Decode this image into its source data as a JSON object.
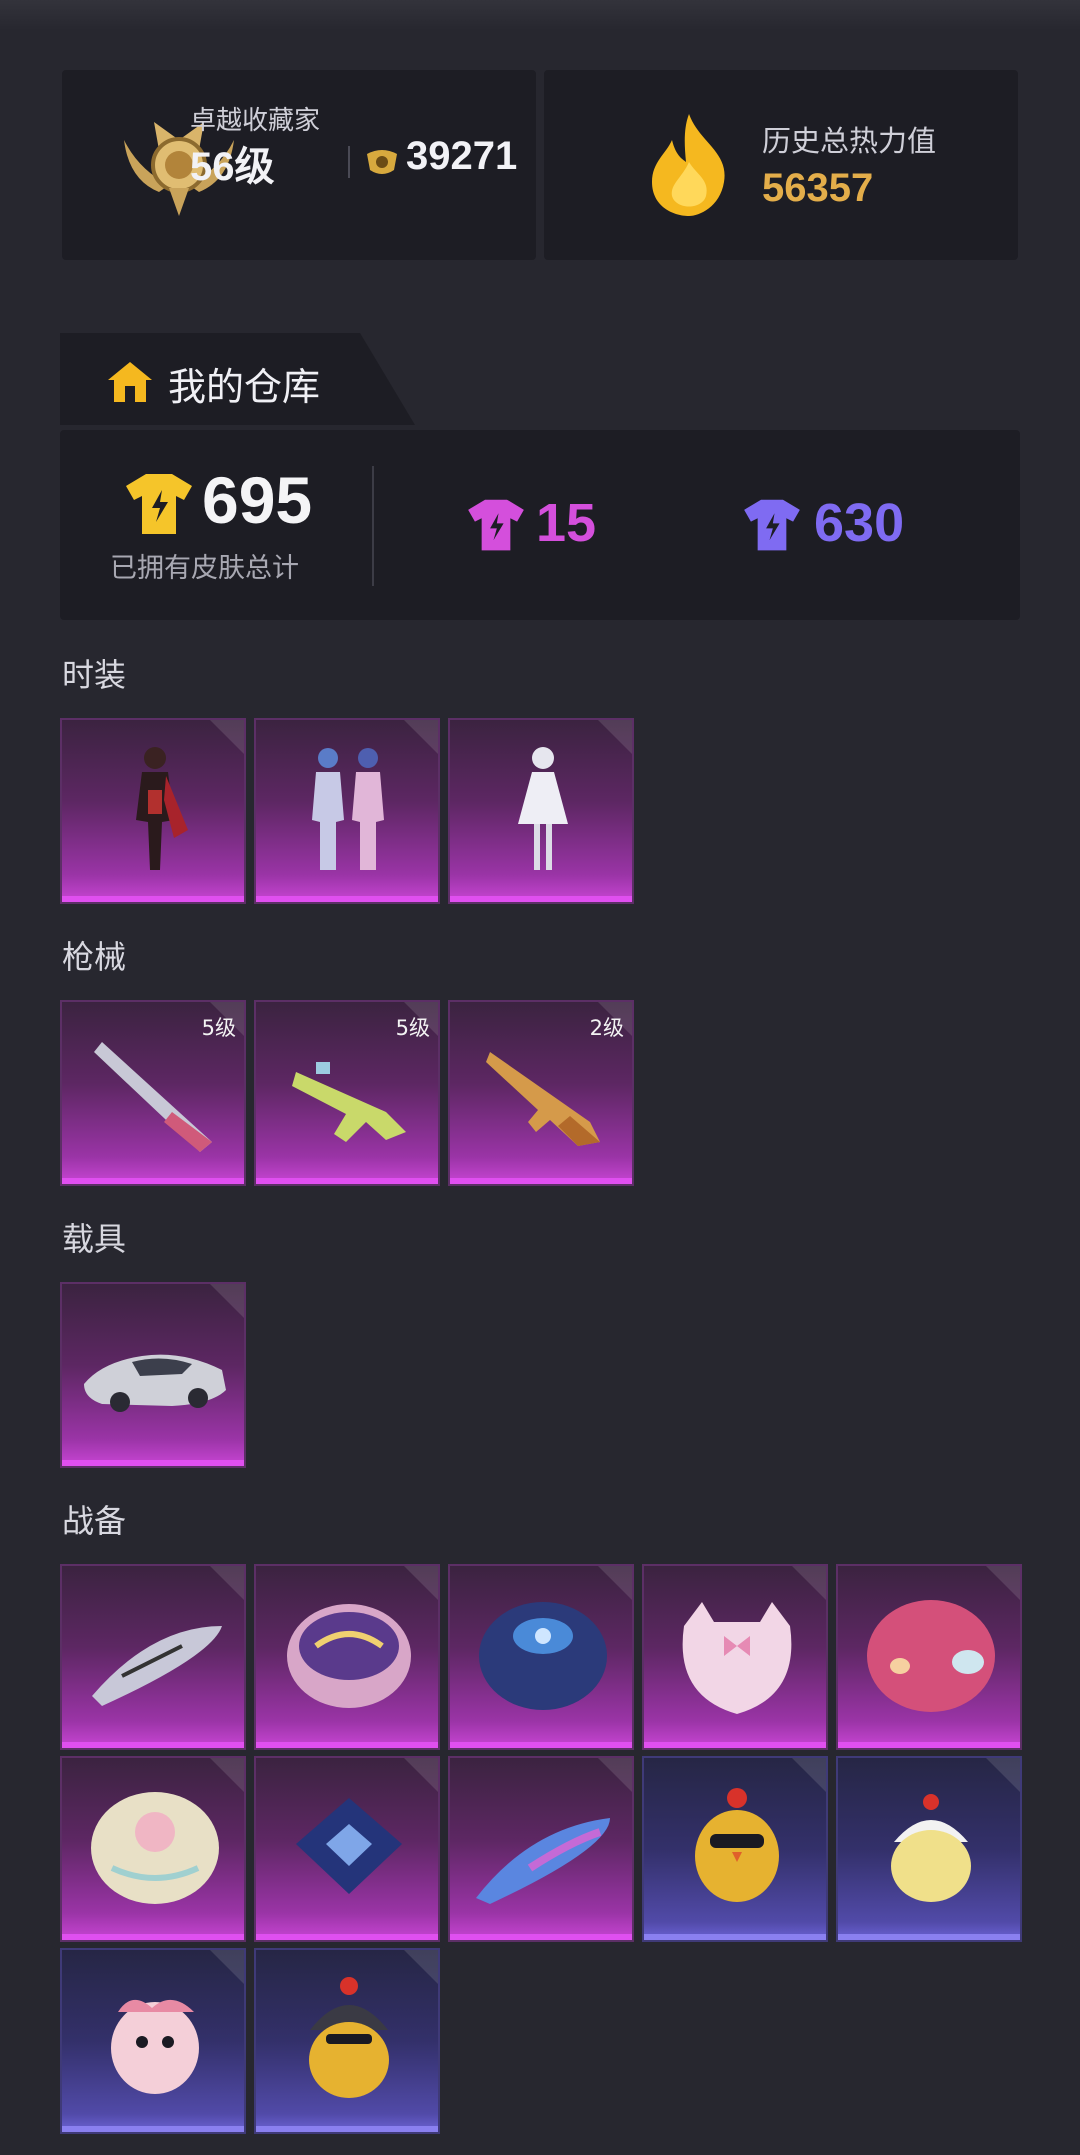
{
  "rank_card": {
    "title": "卓越收藏家",
    "level": "56级",
    "points": "39271",
    "badge_icon": "laurel-medal-icon"
  },
  "heat_card": {
    "title": "历史总热力值",
    "value": "56357",
    "icon": "flame-icon"
  },
  "warehouse": {
    "tab_label": "我的仓库",
    "total_count": "695",
    "total_label": "已拥有皮肤总计",
    "pink_count": "15",
    "purple_count": "630",
    "colors": {
      "gold": "#f5c52a",
      "pink": "#d44fdc",
      "purple": "#7f6bf2"
    }
  },
  "sections": {
    "outfits": {
      "title": "时装",
      "items": [
        {
          "name": "red-armor-outfit"
        },
        {
          "name": "twin-suits-outfit"
        },
        {
          "name": "white-dress-outfit"
        }
      ]
    },
    "weapons": {
      "title": "枪械",
      "items": [
        {
          "name": "shotgun-skin",
          "level": "5级"
        },
        {
          "name": "smg-skin",
          "level": "5级"
        },
        {
          "name": "rifle-skin",
          "level": "2级"
        }
      ]
    },
    "vehicles": {
      "title": "载具",
      "items": [
        {
          "name": "silver-sports-car"
        }
      ]
    },
    "gear": {
      "title": "战备",
      "items": [
        {
          "name": "glider-white"
        },
        {
          "name": "parachute-purple-gold"
        },
        {
          "name": "parachute-blue"
        },
        {
          "name": "parachute-pink-cat"
        },
        {
          "name": "parachute-red-pattern"
        },
        {
          "name": "parachute-cream"
        },
        {
          "name": "parachute-blue-square"
        },
        {
          "name": "glider-blue-purple"
        },
        {
          "name": "chick-sunglasses"
        },
        {
          "name": "chick-white-hat"
        },
        {
          "name": "chick-pink"
        },
        {
          "name": "chick-helmet"
        }
      ]
    }
  }
}
